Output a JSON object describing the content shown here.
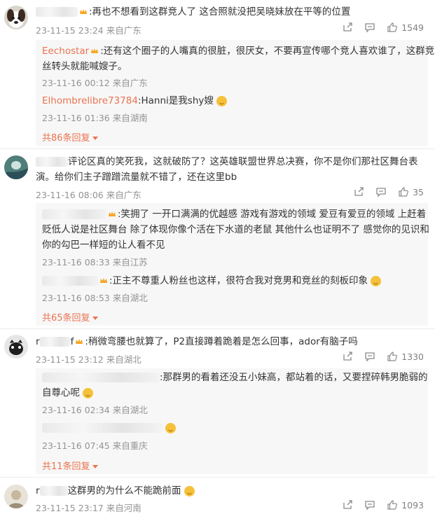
{
  "comments": [
    {
      "text": ":再也不想看到这群竞人了 这合照就没把吴晓妹放在平等的位置",
      "meta": "23-11-15 23:24 来自广东",
      "likes": "1549",
      "replies": [
        {
          "user": "Eechostar",
          "text": ":还有这个圈子的人嘴真的很脏，很厌女，不要再宣传哪个竞人喜欢谁了，这群竞",
          "text2": "丝转头就能喊嫂子。",
          "meta": "23-11-16 00:12 来自广东"
        },
        {
          "user": "Elhombrelibre73784",
          "text": ":Hanni是我shy嫂",
          "meta": "23-11-16 01:36 来自湖南"
        }
      ],
      "more": "共86条回复"
    },
    {
      "text": "评论区真的笑死我，这就破防了？这英雄联盟世界总决赛，你不是你们那社区舞台表",
      "text2": "演。给你们主子蹭蹭流量就不错了，还在这里bb",
      "meta": "23-11-16 08:06 来自广东",
      "likes": "35",
      "replies": [
        {
          "text": ":笑拥了 一开口满满的优越感 游戏有游戏的领域 爱豆有爱豆的领域 上赶着",
          "text2": "贬低人说是社区舞台 除了体现你像个活在下水道的老鼠 其他什么也证明不了 感觉你的见识和",
          "text3": "你的勾巴一样短的让人看不见",
          "meta": "23-11-16 08:33 来自江苏"
        },
        {
          "text": ":正主不尊重人粉丝也这样，很符合我对竞男和竞丝的刻板印象",
          "meta": "23-11-16 08:53 来自湖北"
        }
      ],
      "more": "共65条回复"
    },
    {
      "name_prefix": "r",
      "name_suffix": "f",
      "text": ":稍微弯腰也就算了，P2直接蹲着跪着是怎么回事，ador有脑子吗",
      "meta": "23-11-15 23:12 来自湖北",
      "likes": "1330",
      "replies": [
        {
          "text": ":那群男的看着还没五小妹高，都站着的话，又要捏碎韩男脆弱的",
          "text2": "自尊心呢",
          "meta": "23-11-16 02:34 来自湖北"
        },
        {
          "text": "",
          "meta": "23-11-16 07:45 来自重庆"
        }
      ],
      "more": "共11条回复"
    },
    {
      "name_prefix": "r",
      "text": "这群男的为什么不能跪前面",
      "meta": "23-11-15 23:17 来自河南",
      "likes": "1093"
    }
  ]
}
